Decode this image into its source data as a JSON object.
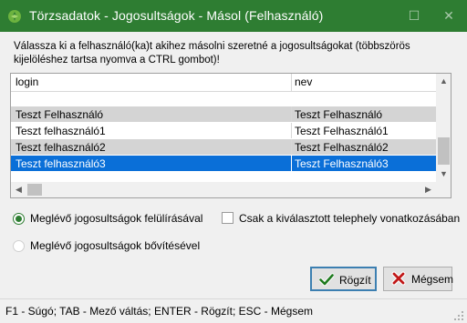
{
  "window": {
    "title": "Törzsadatok - Jogosultságok - Másol (Felhasználó)",
    "maximize_glyph": "☐",
    "close_glyph": "✕",
    "accent_color": "#2e7d32"
  },
  "prompt": "Válassza ki a felhasználó(ka)t akihez másolni szeretné a jogosultságokat (többszörös kijelöléshez tartsa nyomva a CTRL gombot)!",
  "grid": {
    "columns": [
      "login",
      "nev"
    ],
    "rows": [
      {
        "login": "Teszt Felhasználó",
        "nev": "Teszt Felhasználó",
        "state": "gray"
      },
      {
        "login": "Teszt felhasználó1",
        "nev": "Teszt Felhasználó1",
        "state": "white"
      },
      {
        "login": "Teszt felhasználó2",
        "nev": "Teszt Felhasználó2",
        "state": "gray"
      },
      {
        "login": "Teszt felhasználó3",
        "nev": "Teszt Felhasználó3",
        "state": "selected"
      }
    ],
    "selection_color": "#0a6fd8",
    "scroll_up_glyph": "▲",
    "scroll_down_glyph": "▼",
    "scroll_left_glyph": "◀",
    "scroll_right_glyph": "▶"
  },
  "options": {
    "overwrite_label": "Meglévő jogosultságok felülírásával",
    "overwrite_selected": true,
    "extend_label": "Meglévő jogosultságok bővítésével",
    "extend_selected": false,
    "site_only_label": "Csak a kiválasztott telephely vonatkozásában",
    "site_only_checked": false
  },
  "buttons": {
    "save_label": "Rögzít",
    "save_icon": "checkmark-icon",
    "cancel_label": "Mégsem",
    "cancel_icon": "close-icon"
  },
  "status": "F1 - Súgó; TAB - Mező váltás; ENTER - Rögzít; ESC - Mégsem"
}
